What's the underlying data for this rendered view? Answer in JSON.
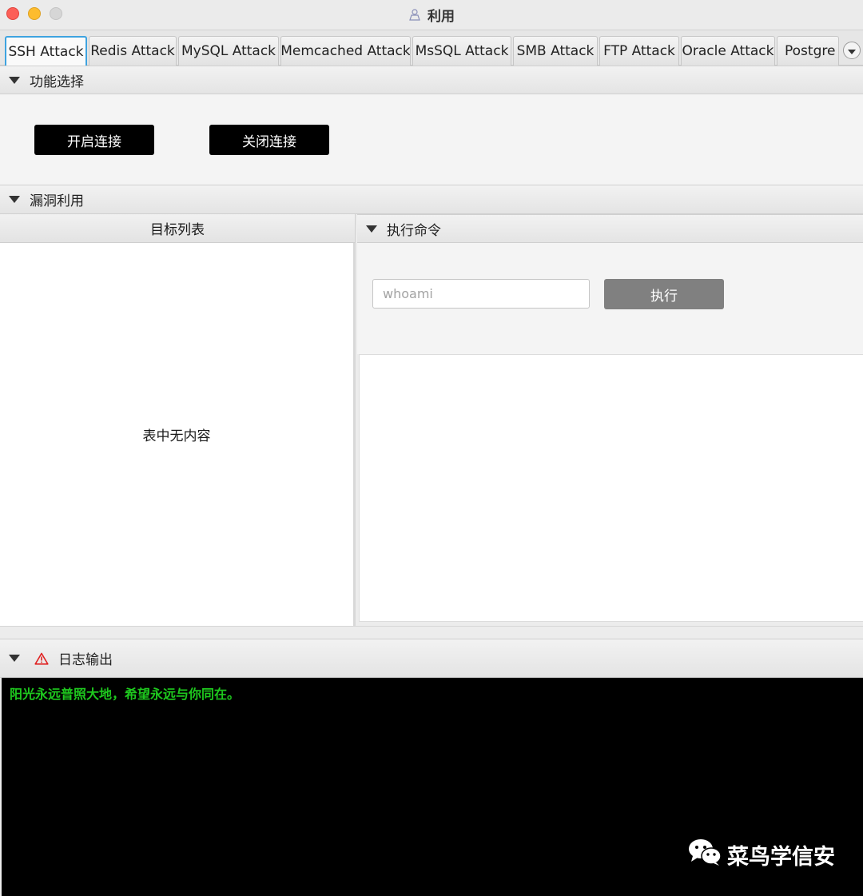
{
  "window": {
    "title": "利用"
  },
  "tabs": [
    {
      "label": "SSH Attack"
    },
    {
      "label": "Redis Attack"
    },
    {
      "label": "MySQL Attack"
    },
    {
      "label": "Memcached Attack"
    },
    {
      "label": "MsSQL Attack"
    },
    {
      "label": "SMB Attack"
    },
    {
      "label": "FTP Attack"
    },
    {
      "label": "Oracle Attack"
    },
    {
      "label": "Postgre A"
    }
  ],
  "function_section": {
    "title": "功能选择",
    "open_button": "开启连接",
    "close_button": "关闭连接"
  },
  "exploit_section": {
    "title": "漏洞利用",
    "target_list": {
      "header": "目标列表",
      "empty_text": "表中无内容"
    },
    "execute": {
      "title": "执行命令",
      "placeholder": "whoami",
      "button": "执行"
    }
  },
  "log_section": {
    "title": "日志输出",
    "lines": [
      "阳光永远普照大地，希望永远与你同在。"
    ]
  },
  "watermark": {
    "text": "菜鸟学信安"
  },
  "colors": {
    "accent": "#3ea3e0",
    "log_text": "#1ec81e",
    "log_bg": "#000000"
  }
}
